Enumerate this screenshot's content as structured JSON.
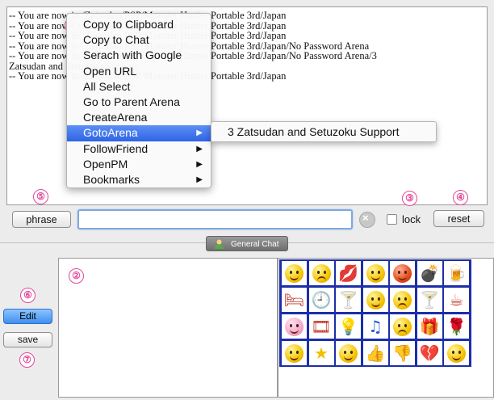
{
  "chat_log": {
    "lines": [
      "-- You are now in /Zatsudan/PSP/Monster Hunter Portable 3rd/Japan",
      "-- You are now in /Zatsudan/PSP/Monster Hunter Portable 3rd/Japan",
      "-- You are now in /Zatsudan/PSP/Monster Hunter Portable 3rd/Japan",
      "-- You are now in /Zatsudan/PSP/Monster Hunter Portable 3rd/Japan/No Password Arena",
      "-- You are now in /Zatsudan/PSP/Monster Hunter Portable 3rd/Japan/No Password Arena/3",
      "Zatsudan and Setuzoku Support",
      "-- You are now in /Zatsudan/PSP/Monster Hunter Portable 3rd/Japan"
    ]
  },
  "controls": {
    "phrase_label": "phrase",
    "message_value": "",
    "lock_label": "lock",
    "lock_checked": false,
    "reset_label": "reset"
  },
  "tab": {
    "label": "General Chat"
  },
  "sidebar": {
    "edit_label": "Edit",
    "save_label": "save"
  },
  "context_menu": {
    "items": [
      {
        "label": "Copy to Clipboard",
        "submenu": false
      },
      {
        "label": "Copy to Chat",
        "submenu": false
      },
      {
        "label": "Serach with Google",
        "submenu": false
      },
      {
        "label": "Open URL",
        "submenu": false
      },
      {
        "label": "All Select",
        "submenu": false
      },
      {
        "label": "Go to Parent Arena",
        "submenu": false
      },
      {
        "label": "CreateArena",
        "submenu": false
      },
      {
        "label": "GotoArena",
        "submenu": true,
        "highlighted": true
      },
      {
        "label": "FollowFriend",
        "submenu": true
      },
      {
        "label": "OpenPM",
        "submenu": true
      },
      {
        "label": "Bookmarks",
        "submenu": true
      }
    ],
    "submenu_item": "3 Zatsudan and Setuzoku Support"
  },
  "callouts": [
    "①",
    "②",
    "③",
    "④",
    "⑤",
    "⑥",
    "⑦"
  ],
  "emoticons": [
    "smile-icon",
    "sad-icon",
    "lips-icon",
    "tongue-icon",
    "angry-icon",
    "bomb-icon",
    "beer-icon",
    "sleeping-icon",
    "clock-icon",
    "cocktail-icon",
    "wink-icon",
    "worried-icon",
    "cocktail-icon",
    "coffee-icon",
    "pig-icon",
    "film-icon",
    "lightbulb-icon",
    "music-icon",
    "shocked-icon",
    "gift-icon",
    "rose-icon",
    "sunglasses-icon",
    "star-icon",
    "grin-icon",
    "thumbs-up-icon",
    "thumbs-down-icon",
    "broken-heart-icon",
    "laugh-icon"
  ],
  "colors": {
    "accent": "#2f64e5",
    "callout": "#e2479a",
    "emoji_grid": "#1c2fa8"
  }
}
